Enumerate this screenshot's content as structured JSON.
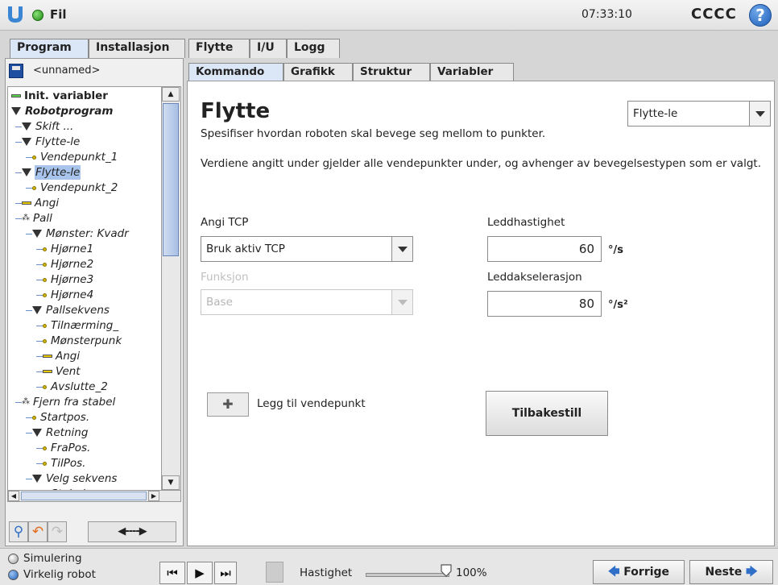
{
  "titlebar": {
    "file_menu": "Fil",
    "clock": "07:33:10",
    "robot_name": "CCCC",
    "help": "?"
  },
  "top_tabs": [
    "Program",
    "Installasjon",
    "Flytte",
    "I/U",
    "Logg"
  ],
  "left": {
    "file_name": "<unnamed>",
    "tree": [
      {
        "label": "Init. variabler",
        "style": "bold",
        "icon": "bar-green",
        "indent": 0
      },
      {
        "label": "Robotprogram",
        "style": "bold-italic",
        "icon": "triangle",
        "indent": 0
      },
      {
        "label": "Skift ...",
        "style": "italic",
        "icon": "triangle",
        "indent": 1
      },
      {
        "label": "Flytte-le",
        "style": "italic",
        "icon": "triangle",
        "indent": 1
      },
      {
        "label": "Vendepunkt_1",
        "style": "italic",
        "icon": "dot",
        "indent": 2
      },
      {
        "label": "Flytte-le",
        "style": "italic",
        "icon": "triangle",
        "indent": 1,
        "selected": true
      },
      {
        "label": "Vendepunkt_2",
        "style": "italic",
        "icon": "dot",
        "indent": 2
      },
      {
        "label": "Angi",
        "style": "italic",
        "icon": "bar",
        "indent": 1
      },
      {
        "label": "Pall",
        "style": "italic",
        "icon": "pall",
        "indent": 1
      },
      {
        "label": "Mønster: Kvadr",
        "style": "italic",
        "icon": "triangle",
        "indent": 2
      },
      {
        "label": "Hjørne1",
        "style": "italic",
        "icon": "dot",
        "indent": 3
      },
      {
        "label": "Hjørne2",
        "style": "italic",
        "icon": "dot",
        "indent": 3
      },
      {
        "label": "Hjørne3",
        "style": "italic",
        "icon": "dot",
        "indent": 3
      },
      {
        "label": "Hjørne4",
        "style": "italic",
        "icon": "dot",
        "indent": 3
      },
      {
        "label": "Pallsekvens",
        "style": "italic",
        "icon": "triangle",
        "indent": 2
      },
      {
        "label": "Tilnærming_",
        "style": "italic",
        "icon": "dot",
        "indent": 3
      },
      {
        "label": "Mønsterpunk",
        "style": "italic",
        "icon": "dot",
        "indent": 3
      },
      {
        "label": "Angi",
        "style": "italic",
        "icon": "bar",
        "indent": 3
      },
      {
        "label": "Vent",
        "style": "italic",
        "icon": "bar",
        "indent": 3
      },
      {
        "label": "Avslutte_2",
        "style": "italic",
        "icon": "dot",
        "indent": 3
      },
      {
        "label": "Fjern fra stabel",
        "style": "italic",
        "icon": "pall",
        "indent": 1
      },
      {
        "label": "Startpos.",
        "style": "italic",
        "icon": "dot",
        "indent": 2
      },
      {
        "label": "Retning",
        "style": "italic",
        "icon": "triangle",
        "indent": 2
      },
      {
        "label": "FraPos.",
        "style": "italic",
        "icon": "dot",
        "indent": 3
      },
      {
        "label": "TilPos.",
        "style": "italic",
        "icon": "dot",
        "indent": 3
      },
      {
        "label": "Velg sekvens",
        "style": "italic",
        "icon": "triangle",
        "indent": 2
      },
      {
        "label": "Stabelpos.",
        "style": "italic",
        "icon": "dot",
        "indent": 3
      }
    ],
    "arrow_button": "◀----▶"
  },
  "content_tabs": [
    "Kommando",
    "Grafikk",
    "Struktur",
    "Variabler"
  ],
  "command": {
    "title": "Flytte",
    "subtitle": "Spesifiser hvordan roboten skal bevege seg mellom to punkter.",
    "description": "Verdiene angitt under gjelder alle vendepunkter under, og avhenger av bevegelsestypen som er valgt.",
    "move_type": "Flytte-le",
    "tcp_label": "Angi TCP",
    "tcp_value": "Bruk aktiv TCP",
    "function_label": "Funksjon",
    "function_value": "Base",
    "joint_speed_label": "Leddhastighet",
    "joint_speed_value": "60",
    "joint_speed_unit": "°/s",
    "joint_accel_label": "Leddakselerasjon",
    "joint_accel_value": "80",
    "joint_accel_unit": "°/s²",
    "add_waypoint_label": "Legg til vendepunkt",
    "reset_label": "Tilbakestill"
  },
  "footer": {
    "simulation": "Simulering",
    "real_robot": "Virkelig robot",
    "speed_label": "Hastighet",
    "speed_value": "100%",
    "speed_level": 1.0,
    "prev": "Forrige",
    "next": "Neste"
  },
  "colors": {
    "accent": "#2f6fc8",
    "selection": "#a9c4ec",
    "status_on": "#1d8a12"
  }
}
